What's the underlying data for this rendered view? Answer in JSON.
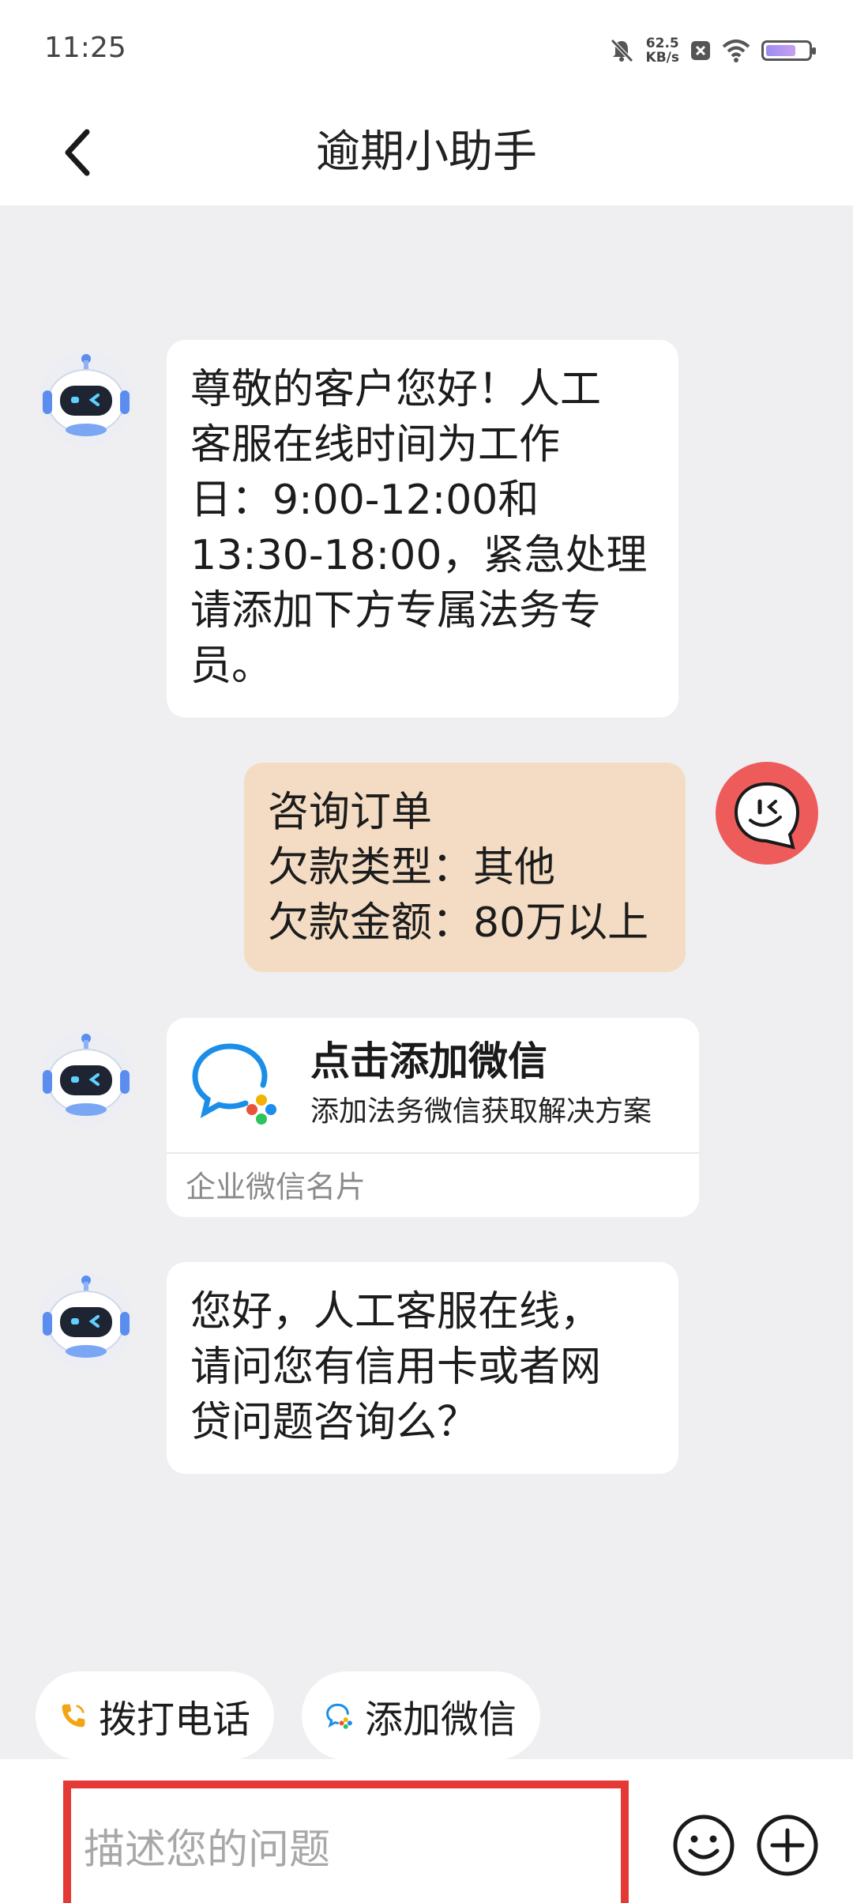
{
  "status_bar": {
    "time": "11:25",
    "speed_value": "62.5",
    "speed_unit": "KB/s",
    "battery_level": 0.72
  },
  "header": {
    "title": "逾期小助手"
  },
  "messages": {
    "welcome": "尊敬的客户您好！人工\n客服在线时间为工作\n日：9:00-12:00和\n13:30-18:00，紧急处理\n请添加下方专属法务专\n员。",
    "user_query": "咨询订单\n欠款类型：其他\n欠款金额：80万以上",
    "wechat_card": {
      "title": "点击添加微信",
      "subtitle": "添加法务微信获取解决方案",
      "footer": "企业微信名片"
    },
    "followup": "您好，人工客服在线，\n请问您有信用卡或者网\n贷问题咨询么？"
  },
  "quick_actions": [
    {
      "label": "拨打电话",
      "icon": "phone-icon"
    },
    {
      "label": "添加微信",
      "icon": "wechat-icon"
    }
  ],
  "composer": {
    "placeholder": "描述您的问题"
  },
  "colors": {
    "accent_red": "#e53935",
    "user_bubble": "#f3dcc3",
    "user_avatar": "#ee5b5b",
    "background": "#efeff1"
  }
}
